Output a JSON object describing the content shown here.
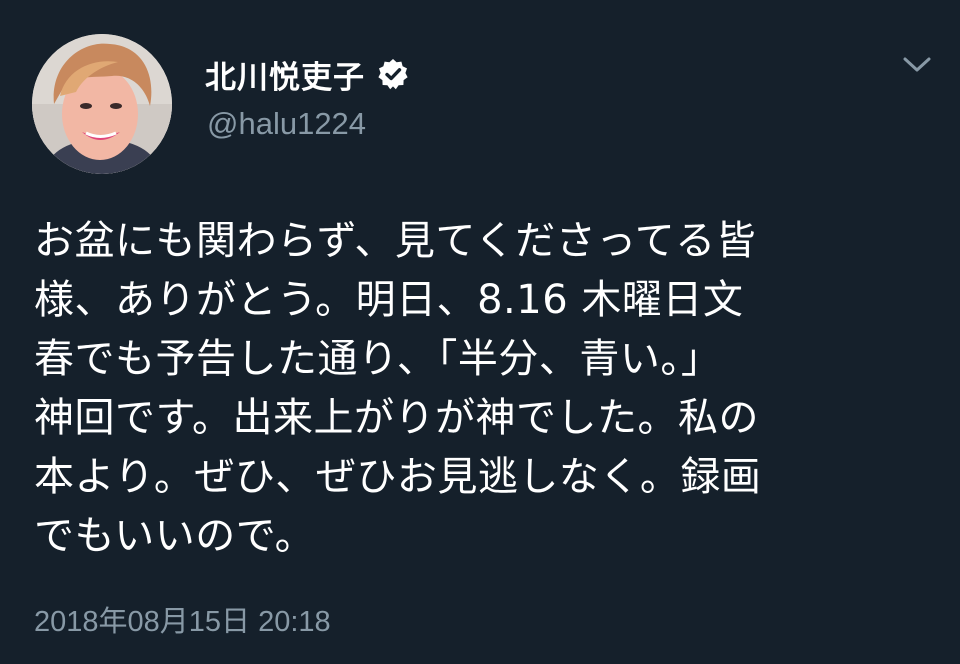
{
  "colors": {
    "background": "#15202b",
    "text_primary": "#ffffff",
    "text_secondary": "#8899a6"
  },
  "author": {
    "display_name": "北川悦吏子",
    "handle": "@halu1224",
    "verified": true,
    "avatar_icon": "profile-photo"
  },
  "menu": {
    "icon": "chevron-down-icon"
  },
  "tweet": {
    "lines": [
      "お盆にも関わらず、見てくださってる皆",
      "様、ありがとう。明日、8.16 木曜日文",
      "春でも予告した通り、「半分、青い。」",
      "神回です。出来上がりが神でした。私の",
      "本より。ぜひ、ぜひお見逃しなく。録画",
      "でもいいので。"
    ],
    "timestamp": "2018年08月15日 20:18"
  }
}
